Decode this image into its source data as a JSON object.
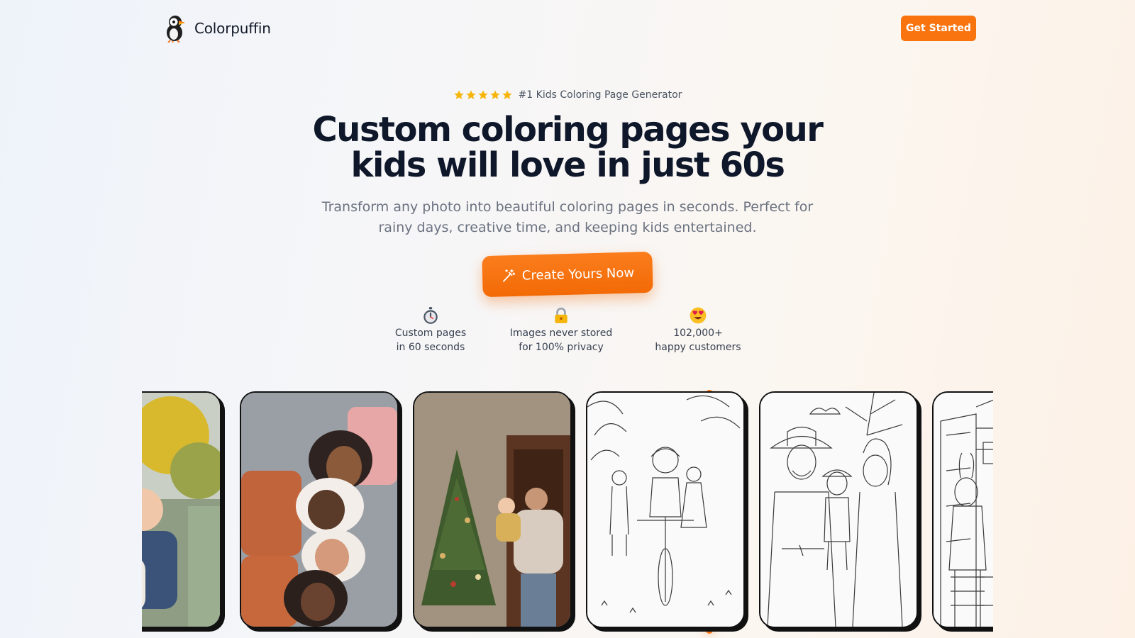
{
  "header": {
    "brand_name": "Colorpuffin",
    "get_started_label": "Get Started"
  },
  "hero": {
    "rating_stars": 5,
    "badge_text": "#1 Kids Coloring Page Generator",
    "title_line1": "Custom coloring pages your",
    "title_line2": "kids will love in just 60s",
    "subtitle_line1": "Transform any photo into beautiful coloring pages in seconds. Perfect for",
    "subtitle_line2": "rainy days, creative time, and keeping kids entertained.",
    "cta_label": "Create Yours Now"
  },
  "features": [
    {
      "icon": "stopwatch-icon",
      "line1": "Custom pages",
      "line2": "in 60 seconds"
    },
    {
      "icon": "lock-icon",
      "line1": "Images never stored",
      "line2": "for 100% privacy"
    },
    {
      "icon": "heart-eyes-icon",
      "line1": "102,000+",
      "line2": "happy customers"
    }
  ],
  "gallery": {
    "cards": [
      {
        "kind": "photo",
        "subject": "child-with-dog-outdoors"
      },
      {
        "kind": "photo",
        "subject": "four-kids-lying-heads-together"
      },
      {
        "kind": "photo",
        "subject": "father-and-baby-decorating-christmas-tree"
      },
      {
        "kind": "coloring-page",
        "subject": "child-riding-bike-with-parents"
      },
      {
        "kind": "coloring-page",
        "subject": "family-with-cowboy-hats"
      },
      {
        "kind": "coloring-page",
        "subject": "girl-with-bunny-ears-on-porch"
      }
    ]
  },
  "colors": {
    "accent": "#f9740e",
    "title": "#0f172a",
    "subtitle": "#6b7280",
    "star": "#f5b50a"
  }
}
